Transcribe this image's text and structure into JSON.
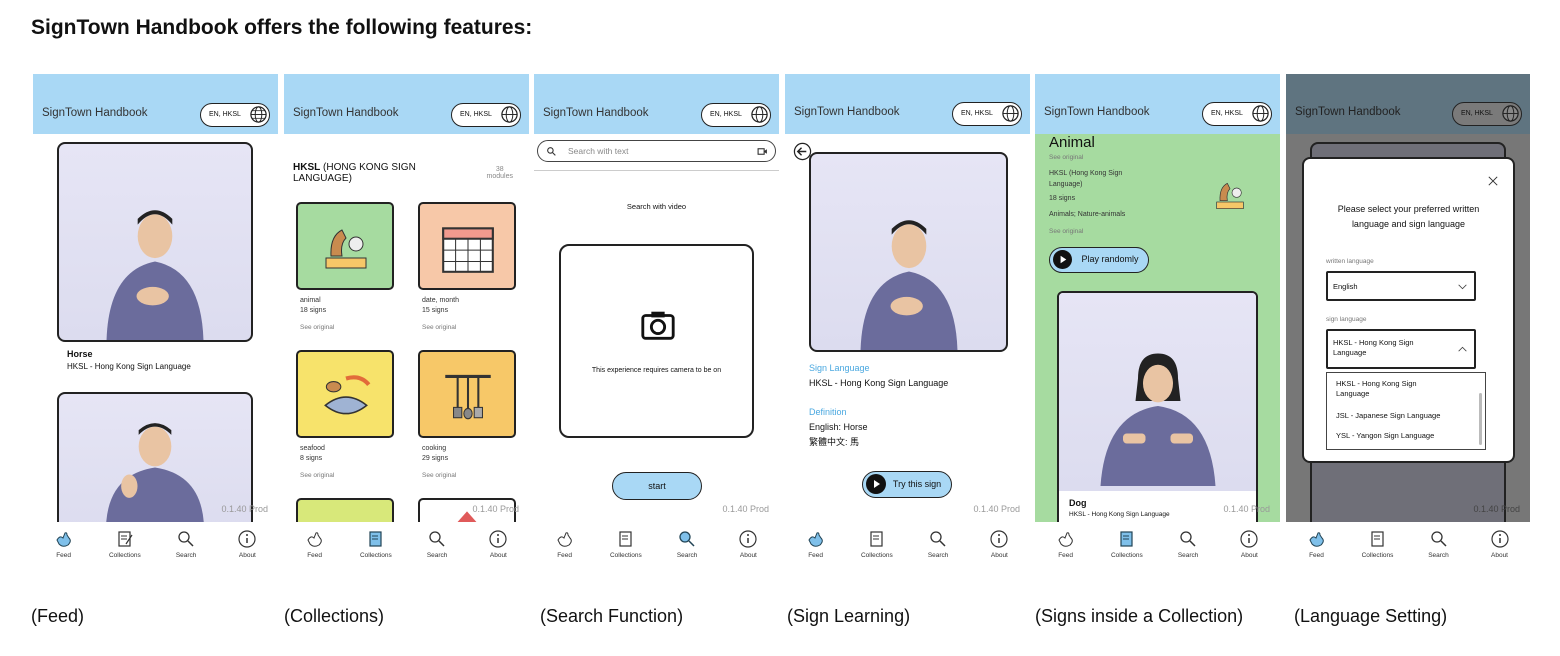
{
  "page_title": "SignTown Handbook offers the following features:",
  "app_name": "SignTown Handbook",
  "lang_badge": "EN, HKSL",
  "version": "0.1.40 Prod",
  "tabs": {
    "feed": "Feed",
    "collections": "Collections",
    "search": "Search",
    "about": "About"
  },
  "captions": [
    "(Feed)",
    "(Collections)",
    "(Search Function)",
    "(Sign Learning)",
    "(Signs inside a Collection)",
    "(Language Setting)"
  ],
  "feed": {
    "item_title": "Horse",
    "item_sub": "HKSL - Hong Kong Sign Language"
  },
  "collections": {
    "hksl_bold": "HKSL",
    "hksl_rest": "(HONG KONG SIGN LANGUAGE)",
    "module_count": "38",
    "module_label": "modules",
    "see_original": "See original",
    "cards": [
      {
        "name": "animal",
        "count": "18 signs"
      },
      {
        "name": "date, month",
        "count": "15 signs"
      },
      {
        "name": "seafood",
        "count": "8 signs"
      },
      {
        "name": "cooking",
        "count": "29 signs"
      }
    ]
  },
  "search": {
    "placeholder": "Search with text",
    "video_label": "Search with video",
    "camera_msg": "This experience requires camera to be on",
    "start": "start"
  },
  "learning": {
    "sl_label": "Sign Language",
    "sl_value": "HKSL - Hong Kong Sign Language",
    "def_label": "Definition",
    "def_en": "English: Horse",
    "def_zh": "繁體中文: 馬",
    "try": "Try this sign"
  },
  "inside": {
    "title": "Animal",
    "see_original": "See original",
    "lang": "HKSL (Hong Kong Sign Language)",
    "count": "18 signs",
    "tags": "Animals; Nature-animals",
    "play": "Play randomly",
    "dog_title": "Dog",
    "dog_sub": "HKSL - Hong Kong Sign Language"
  },
  "settings": {
    "prompt": "Please select your preferred written language and sign language",
    "written_label": "written language",
    "written_value": "English",
    "sign_label": "sign language",
    "sign_value": "HKSL - Hong Kong Sign Language",
    "options": [
      "HKSL - Hong Kong Sign Language",
      "JSL - Japanese Sign Language",
      "YSL - Yangon Sign Language"
    ]
  },
  "colors": {
    "header": "#a9d8f5",
    "green": "#a6dba0",
    "accent_blue": "#4aa8e0"
  }
}
